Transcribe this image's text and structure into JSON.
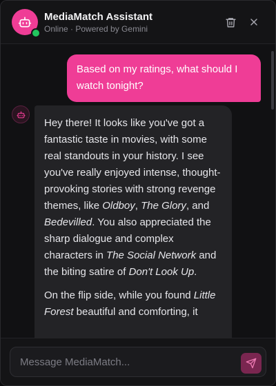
{
  "header": {
    "title": "MediaMatch Assistant",
    "subtitle": "Online · Powered by Gemini",
    "avatar_icon": "robot-icon",
    "status": "online",
    "actions": [
      {
        "name": "delete",
        "icon": "trash-icon"
      },
      {
        "name": "close",
        "icon": "close-icon"
      }
    ]
  },
  "messages": [
    {
      "role": "user",
      "text": "Based on my ratings, what should I watch tonight?"
    },
    {
      "role": "assistant",
      "icon": "robot-icon",
      "paragraphs": [
        {
          "parts": [
            {
              "text": "Hey there! It looks like you've got a fantastic taste in movies, with some real standouts in your history. I see you've really enjoyed intense, thought-provoking stories with strong revenge themes, like ",
              "em": false
            },
            {
              "text": "Oldboy",
              "em": true
            },
            {
              "text": ", ",
              "em": false
            },
            {
              "text": "The Glory",
              "em": true
            },
            {
              "text": ", and ",
              "em": false
            },
            {
              "text": "Bedevilled",
              "em": true
            },
            {
              "text": ". You also appreciated the sharp dialogue and complex characters in ",
              "em": false
            },
            {
              "text": "The Social Network",
              "em": true
            },
            {
              "text": " and the biting satire of ",
              "em": false
            },
            {
              "text": "Don't Look Up",
              "em": true
            },
            {
              "text": ".",
              "em": false
            }
          ]
        },
        {
          "parts": [
            {
              "text": "On the flip side, while you found ",
              "em": false
            },
            {
              "text": "Little Forest",
              "em": true
            },
            {
              "text": " beautiful and comforting, it",
              "em": false
            }
          ]
        }
      ]
    }
  ],
  "composer": {
    "placeholder": "Message MediaMatch...",
    "value": "",
    "send_icon": "send-icon"
  },
  "colors": {
    "accent": "#ef3d96",
    "online": "#22c55e",
    "background": "#111113",
    "bot_bubble": "#232326",
    "send_disabled": "#7a2650"
  }
}
